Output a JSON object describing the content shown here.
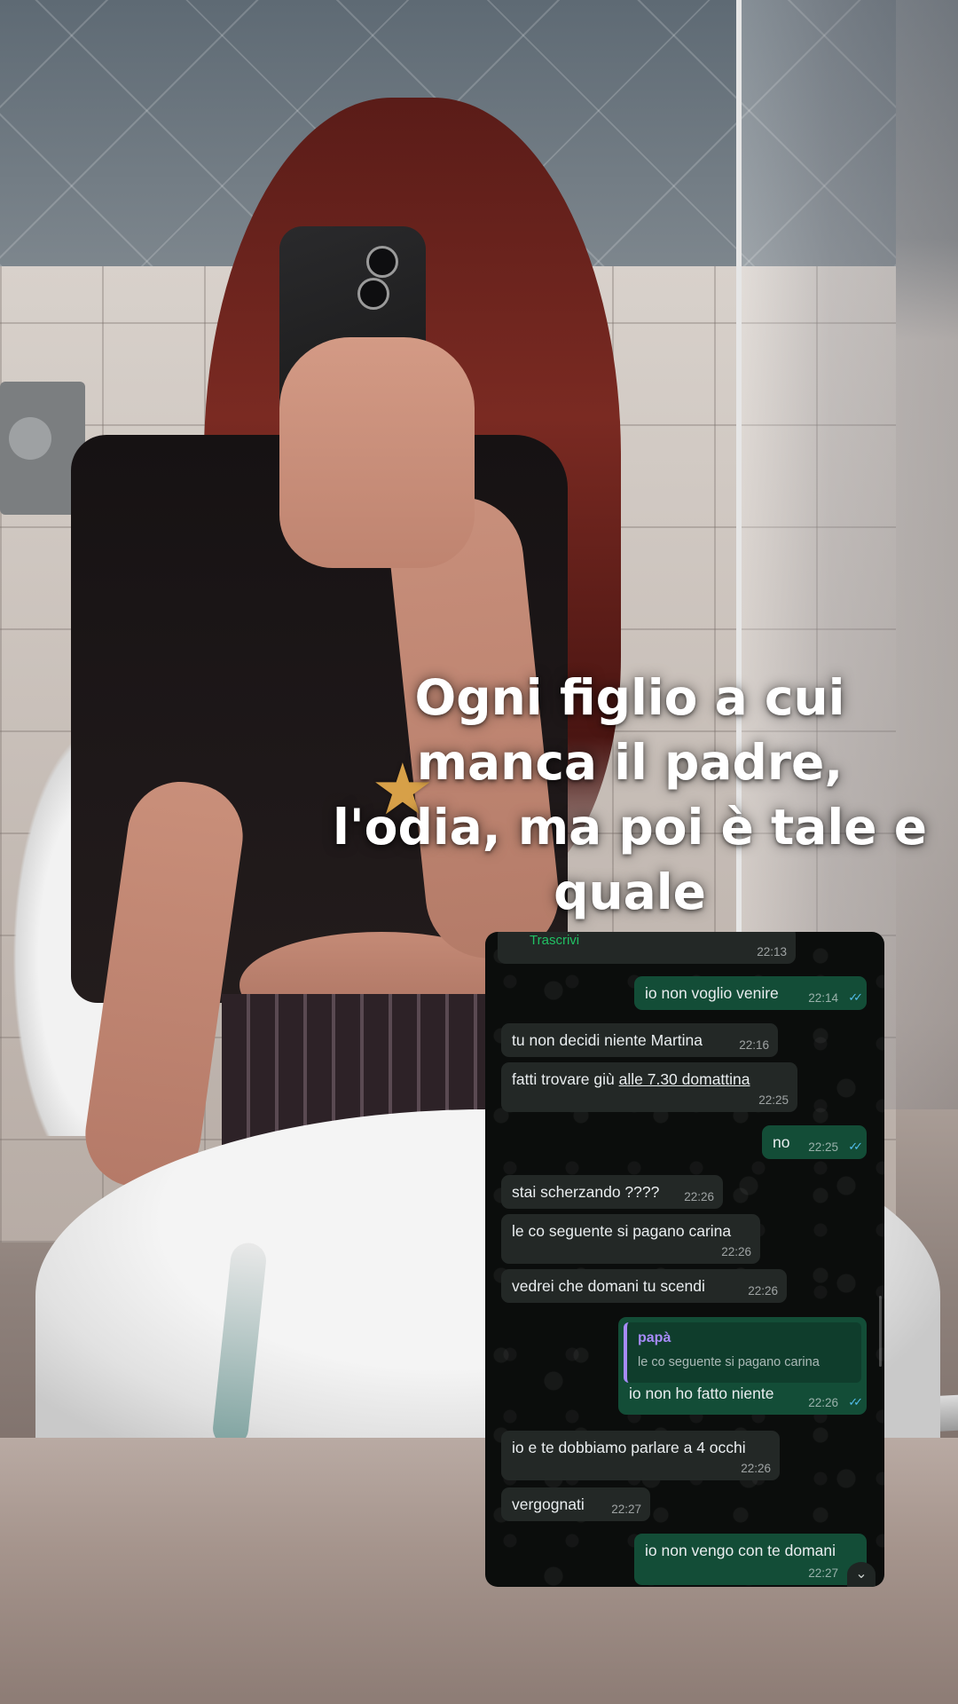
{
  "story": {
    "caption": "Ogni figlio a cui\nmanca il padre,\nl'odia, ma poi è tale e\nquale",
    "sticker": "★"
  },
  "chat": {
    "transcribe_label": "Trascrivi",
    "messages": [
      {
        "dir": "in",
        "text": "",
        "time": "22:13"
      },
      {
        "dir": "out",
        "text": "io non voglio venire",
        "time": "22:14"
      },
      {
        "dir": "in",
        "text": "tu non decidi niente Martina",
        "time": "22:16"
      },
      {
        "dir": "in",
        "text_before": "fatti trovare giù ",
        "text_link": "alle 7.30 domattina",
        "time": "22:25"
      },
      {
        "dir": "out",
        "text": "no",
        "time": "22:25"
      },
      {
        "dir": "in",
        "text": "stai scherzando ????",
        "time": "22:26"
      },
      {
        "dir": "in",
        "text": "le co seguente si pagano carina",
        "time": "22:26"
      },
      {
        "dir": "in",
        "text": "vedrei che domani tu scendi",
        "time": "22:26"
      },
      {
        "dir": "out",
        "quote_name": "papà",
        "quote_text": "le co seguente si pagano carina",
        "text": "io non ho fatto niente",
        "time": "22:26"
      },
      {
        "dir": "in",
        "text": "io e te dobbiamo parlare a 4 occhi",
        "time": "22:26"
      },
      {
        "dir": "in",
        "text": "vergognati",
        "time": "22:27"
      },
      {
        "dir": "out",
        "text": "io non vengo con te domani",
        "time": "22:27"
      }
    ],
    "read_ticks": "✓✓",
    "scroll_down_icon": "chevron-down-icon",
    "colors": {
      "incoming": "#232826",
      "outgoing": "#134d37",
      "ticks": "#53bdeb",
      "transcribe": "#21c063",
      "quote_bar": "#a78bfa"
    }
  }
}
